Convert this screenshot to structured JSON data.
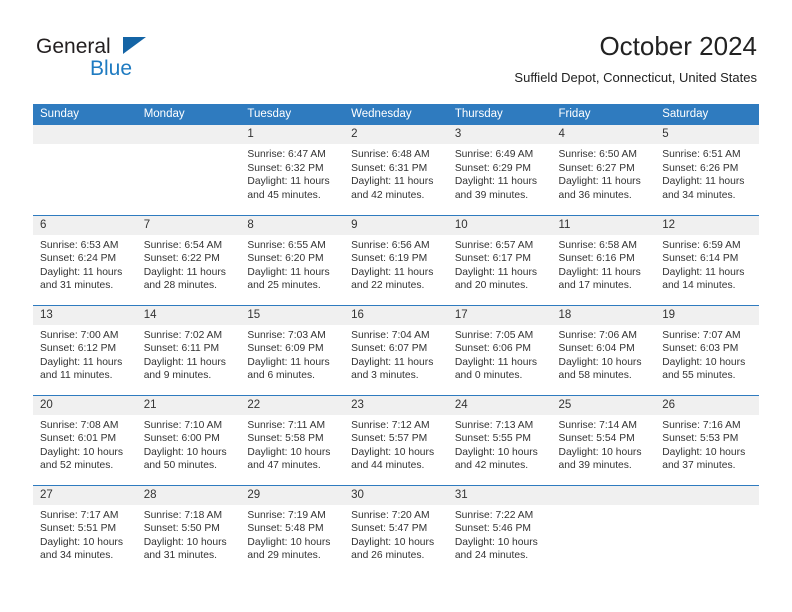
{
  "brand": {
    "name_part1": "General",
    "name_part2": "Blue",
    "triangle_color": "#1464a5",
    "blue_color": "#1f7bc1"
  },
  "header": {
    "title": "October 2024",
    "location": "Suffield Depot, Connecticut, United States"
  },
  "theme": {
    "header_bg": "#2f7bbf",
    "daynum_bg": "#f0f0f0",
    "separator": "#2f7bbf",
    "text": "#333333"
  },
  "weekday_headers": [
    "Sunday",
    "Monday",
    "Tuesday",
    "Wednesday",
    "Thursday",
    "Friday",
    "Saturday"
  ],
  "weeks": [
    [
      {
        "day": "",
        "empty": true,
        "sunrise": "",
        "sunset": "",
        "daylight_line1": "",
        "daylight_line2": ""
      },
      {
        "day": "",
        "empty": true,
        "sunrise": "",
        "sunset": "",
        "daylight_line1": "",
        "daylight_line2": ""
      },
      {
        "day": "1",
        "sunrise": "Sunrise: 6:47 AM",
        "sunset": "Sunset: 6:32 PM",
        "daylight_line1": "Daylight: 11 hours",
        "daylight_line2": "and 45 minutes."
      },
      {
        "day": "2",
        "sunrise": "Sunrise: 6:48 AM",
        "sunset": "Sunset: 6:31 PM",
        "daylight_line1": "Daylight: 11 hours",
        "daylight_line2": "and 42 minutes."
      },
      {
        "day": "3",
        "sunrise": "Sunrise: 6:49 AM",
        "sunset": "Sunset: 6:29 PM",
        "daylight_line1": "Daylight: 11 hours",
        "daylight_line2": "and 39 minutes."
      },
      {
        "day": "4",
        "sunrise": "Sunrise: 6:50 AM",
        "sunset": "Sunset: 6:27 PM",
        "daylight_line1": "Daylight: 11 hours",
        "daylight_line2": "and 36 minutes."
      },
      {
        "day": "5",
        "sunrise": "Sunrise: 6:51 AM",
        "sunset": "Sunset: 6:26 PM",
        "daylight_line1": "Daylight: 11 hours",
        "daylight_line2": "and 34 minutes."
      }
    ],
    [
      {
        "day": "6",
        "sunrise": "Sunrise: 6:53 AM",
        "sunset": "Sunset: 6:24 PM",
        "daylight_line1": "Daylight: 11 hours",
        "daylight_line2": "and 31 minutes."
      },
      {
        "day": "7",
        "sunrise": "Sunrise: 6:54 AM",
        "sunset": "Sunset: 6:22 PM",
        "daylight_line1": "Daylight: 11 hours",
        "daylight_line2": "and 28 minutes."
      },
      {
        "day": "8",
        "sunrise": "Sunrise: 6:55 AM",
        "sunset": "Sunset: 6:20 PM",
        "daylight_line1": "Daylight: 11 hours",
        "daylight_line2": "and 25 minutes."
      },
      {
        "day": "9",
        "sunrise": "Sunrise: 6:56 AM",
        "sunset": "Sunset: 6:19 PM",
        "daylight_line1": "Daylight: 11 hours",
        "daylight_line2": "and 22 minutes."
      },
      {
        "day": "10",
        "sunrise": "Sunrise: 6:57 AM",
        "sunset": "Sunset: 6:17 PM",
        "daylight_line1": "Daylight: 11 hours",
        "daylight_line2": "and 20 minutes."
      },
      {
        "day": "11",
        "sunrise": "Sunrise: 6:58 AM",
        "sunset": "Sunset: 6:16 PM",
        "daylight_line1": "Daylight: 11 hours",
        "daylight_line2": "and 17 minutes."
      },
      {
        "day": "12",
        "sunrise": "Sunrise: 6:59 AM",
        "sunset": "Sunset: 6:14 PM",
        "daylight_line1": "Daylight: 11 hours",
        "daylight_line2": "and 14 minutes."
      }
    ],
    [
      {
        "day": "13",
        "sunrise": "Sunrise: 7:00 AM",
        "sunset": "Sunset: 6:12 PM",
        "daylight_line1": "Daylight: 11 hours",
        "daylight_line2": "and 11 minutes."
      },
      {
        "day": "14",
        "sunrise": "Sunrise: 7:02 AM",
        "sunset": "Sunset: 6:11 PM",
        "daylight_line1": "Daylight: 11 hours",
        "daylight_line2": "and 9 minutes."
      },
      {
        "day": "15",
        "sunrise": "Sunrise: 7:03 AM",
        "sunset": "Sunset: 6:09 PM",
        "daylight_line1": "Daylight: 11 hours",
        "daylight_line2": "and 6 minutes."
      },
      {
        "day": "16",
        "sunrise": "Sunrise: 7:04 AM",
        "sunset": "Sunset: 6:07 PM",
        "daylight_line1": "Daylight: 11 hours",
        "daylight_line2": "and 3 minutes."
      },
      {
        "day": "17",
        "sunrise": "Sunrise: 7:05 AM",
        "sunset": "Sunset: 6:06 PM",
        "daylight_line1": "Daylight: 11 hours",
        "daylight_line2": "and 0 minutes."
      },
      {
        "day": "18",
        "sunrise": "Sunrise: 7:06 AM",
        "sunset": "Sunset: 6:04 PM",
        "daylight_line1": "Daylight: 10 hours",
        "daylight_line2": "and 58 minutes."
      },
      {
        "day": "19",
        "sunrise": "Sunrise: 7:07 AM",
        "sunset": "Sunset: 6:03 PM",
        "daylight_line1": "Daylight: 10 hours",
        "daylight_line2": "and 55 minutes."
      }
    ],
    [
      {
        "day": "20",
        "sunrise": "Sunrise: 7:08 AM",
        "sunset": "Sunset: 6:01 PM",
        "daylight_line1": "Daylight: 10 hours",
        "daylight_line2": "and 52 minutes."
      },
      {
        "day": "21",
        "sunrise": "Sunrise: 7:10 AM",
        "sunset": "Sunset: 6:00 PM",
        "daylight_line1": "Daylight: 10 hours",
        "daylight_line2": "and 50 minutes."
      },
      {
        "day": "22",
        "sunrise": "Sunrise: 7:11 AM",
        "sunset": "Sunset: 5:58 PM",
        "daylight_line1": "Daylight: 10 hours",
        "daylight_line2": "and 47 minutes."
      },
      {
        "day": "23",
        "sunrise": "Sunrise: 7:12 AM",
        "sunset": "Sunset: 5:57 PM",
        "daylight_line1": "Daylight: 10 hours",
        "daylight_line2": "and 44 minutes."
      },
      {
        "day": "24",
        "sunrise": "Sunrise: 7:13 AM",
        "sunset": "Sunset: 5:55 PM",
        "daylight_line1": "Daylight: 10 hours",
        "daylight_line2": "and 42 minutes."
      },
      {
        "day": "25",
        "sunrise": "Sunrise: 7:14 AM",
        "sunset": "Sunset: 5:54 PM",
        "daylight_line1": "Daylight: 10 hours",
        "daylight_line2": "and 39 minutes."
      },
      {
        "day": "26",
        "sunrise": "Sunrise: 7:16 AM",
        "sunset": "Sunset: 5:53 PM",
        "daylight_line1": "Daylight: 10 hours",
        "daylight_line2": "and 37 minutes."
      }
    ],
    [
      {
        "day": "27",
        "sunrise": "Sunrise: 7:17 AM",
        "sunset": "Sunset: 5:51 PM",
        "daylight_line1": "Daylight: 10 hours",
        "daylight_line2": "and 34 minutes."
      },
      {
        "day": "28",
        "sunrise": "Sunrise: 7:18 AM",
        "sunset": "Sunset: 5:50 PM",
        "daylight_line1": "Daylight: 10 hours",
        "daylight_line2": "and 31 minutes."
      },
      {
        "day": "29",
        "sunrise": "Sunrise: 7:19 AM",
        "sunset": "Sunset: 5:48 PM",
        "daylight_line1": "Daylight: 10 hours",
        "daylight_line2": "and 29 minutes."
      },
      {
        "day": "30",
        "sunrise": "Sunrise: 7:20 AM",
        "sunset": "Sunset: 5:47 PM",
        "daylight_line1": "Daylight: 10 hours",
        "daylight_line2": "and 26 minutes."
      },
      {
        "day": "31",
        "sunrise": "Sunrise: 7:22 AM",
        "sunset": "Sunset: 5:46 PM",
        "daylight_line1": "Daylight: 10 hours",
        "daylight_line2": "and 24 minutes."
      },
      {
        "day": "",
        "empty": true,
        "sunrise": "",
        "sunset": "",
        "daylight_line1": "",
        "daylight_line2": ""
      },
      {
        "day": "",
        "empty": true,
        "sunrise": "",
        "sunset": "",
        "daylight_line1": "",
        "daylight_line2": ""
      }
    ]
  ]
}
